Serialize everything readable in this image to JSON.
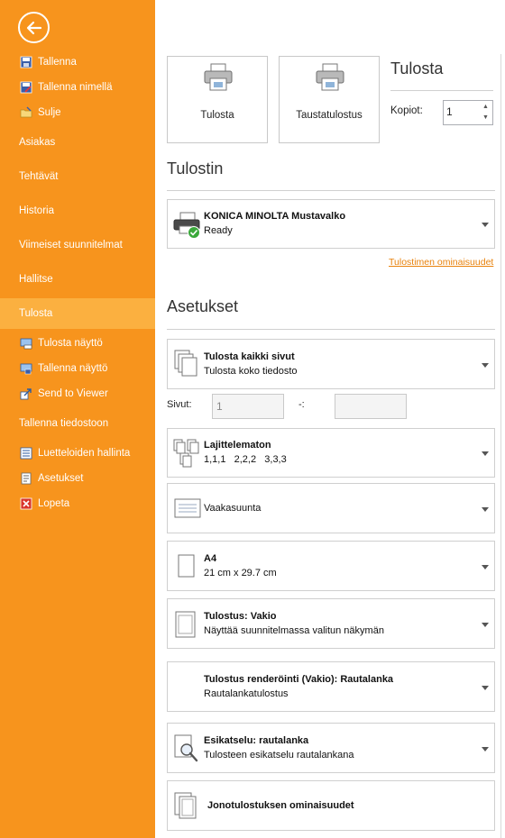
{
  "sidebar": {
    "items": [
      {
        "label": "Tallenna",
        "icon": "save-icon"
      },
      {
        "label": "Tallenna nimellä",
        "icon": "save-as-icon"
      },
      {
        "label": "Sulje",
        "icon": "folder-close-icon"
      },
      {
        "label": "Asiakas"
      },
      {
        "label": "Tehtävät"
      },
      {
        "label": "Historia"
      },
      {
        "label": "Viimeiset suunnitelmat"
      },
      {
        "label": "Hallitse"
      },
      {
        "label": "Tulosta"
      },
      {
        "label": "Tulosta näyttö",
        "icon": "print-screen-icon"
      },
      {
        "label": "Tallenna näyttö",
        "icon": "save-screen-icon"
      },
      {
        "label": "Send to Viewer",
        "icon": "send-to-viewer-icon"
      },
      {
        "label": "Tallenna tiedostoon"
      },
      {
        "label": "Luetteloiden hallinta",
        "icon": "list-management-icon"
      },
      {
        "label": "Asetukset",
        "icon": "settings-icon"
      },
      {
        "label": "Lopeta",
        "icon": "exit-icon"
      }
    ],
    "active": "Tulosta"
  },
  "print": {
    "button_print": "Tulosta",
    "button_background": "Taustatulostus",
    "title": "Tulosta",
    "copies_label": "Kopiot:",
    "copies_value": "1"
  },
  "printer": {
    "section_title": "Tulostin",
    "name": "KONICA MINOLTA Mustavalko",
    "status": "Ready",
    "properties_link": "Tulostimen ominaisuudet"
  },
  "settings": {
    "section_title": "Asetukset",
    "pages_mode": {
      "title": "Tulosta kaikki sivut",
      "desc": "Tulosta koko tiedosto"
    },
    "pages_label": "Sivut:",
    "pages_from": "1",
    "pages_sep": "-:",
    "pages_to": "",
    "collation": {
      "title": "Lajittelematon",
      "desc": "1,1,1   2,2,2   3,3,3"
    },
    "orientation": {
      "title": "Vaakasuunta"
    },
    "paper": {
      "title": "A4",
      "desc": "21 cm x 29.7 cm"
    },
    "print_type": {
      "title": "Tulostus: Vakio",
      "desc": "Näyttää suunnitelmassa valitun näkymän"
    },
    "rendering": {
      "title": "Tulostus renderöinti (Vakio): Rautalanka",
      "desc": "Rautalankatulostus"
    },
    "preview": {
      "title": "Esikatselu: rautalanka",
      "desc": "Tulosteen esikatselu rautalankana"
    },
    "queue": {
      "title": "Jonotulostuksen ominaisuudet"
    }
  },
  "colors": {
    "sidebar": "#F7941D",
    "sidebar_active": "#FBB040",
    "link": "#E8820C"
  }
}
